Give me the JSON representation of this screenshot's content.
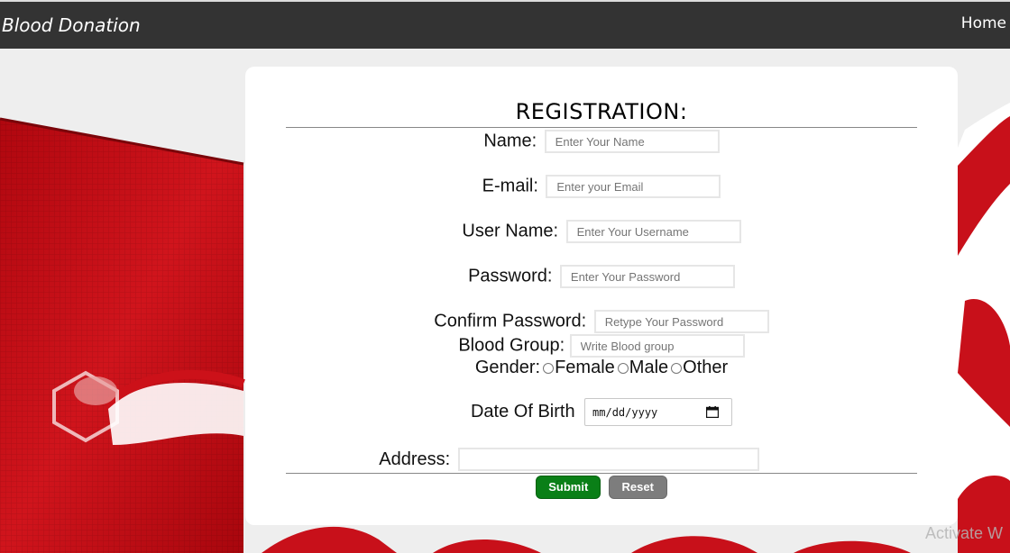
{
  "header": {
    "brand": "Blood Donation",
    "nav_home": "Home"
  },
  "form": {
    "title": "REGISTRATION:",
    "name": {
      "label": "Name:",
      "placeholder": "Enter Your Name"
    },
    "email": {
      "label": "E-mail:",
      "placeholder": "Enter your Email"
    },
    "username": {
      "label": "User Name:",
      "placeholder": "Enter Your Username"
    },
    "password": {
      "label": "Password:",
      "placeholder": "Enter Your Password"
    },
    "confirm_password": {
      "label": "Confirm Password:",
      "placeholder": "Retype Your Password"
    },
    "blood_group": {
      "label": "Blood Group:",
      "placeholder": "Write Blood group"
    },
    "gender": {
      "label": "Gender:",
      "options": [
        "Female",
        "Male",
        "Other"
      ]
    },
    "dob": {
      "label": "Date Of Birth",
      "placeholder": "mm/dd/yyyy"
    },
    "address": {
      "label": "Address:",
      "value": ""
    },
    "submit_label": "Submit",
    "reset_label": "Reset"
  },
  "watermark": "Activate W",
  "icons": {
    "calendar": "calendar-icon",
    "radio": "radio-unchecked-icon"
  },
  "colors": {
    "topbar": "#333333",
    "submit": "#0a7f17",
    "reset": "#7d7d7d",
    "background_red": "#c8101a"
  }
}
